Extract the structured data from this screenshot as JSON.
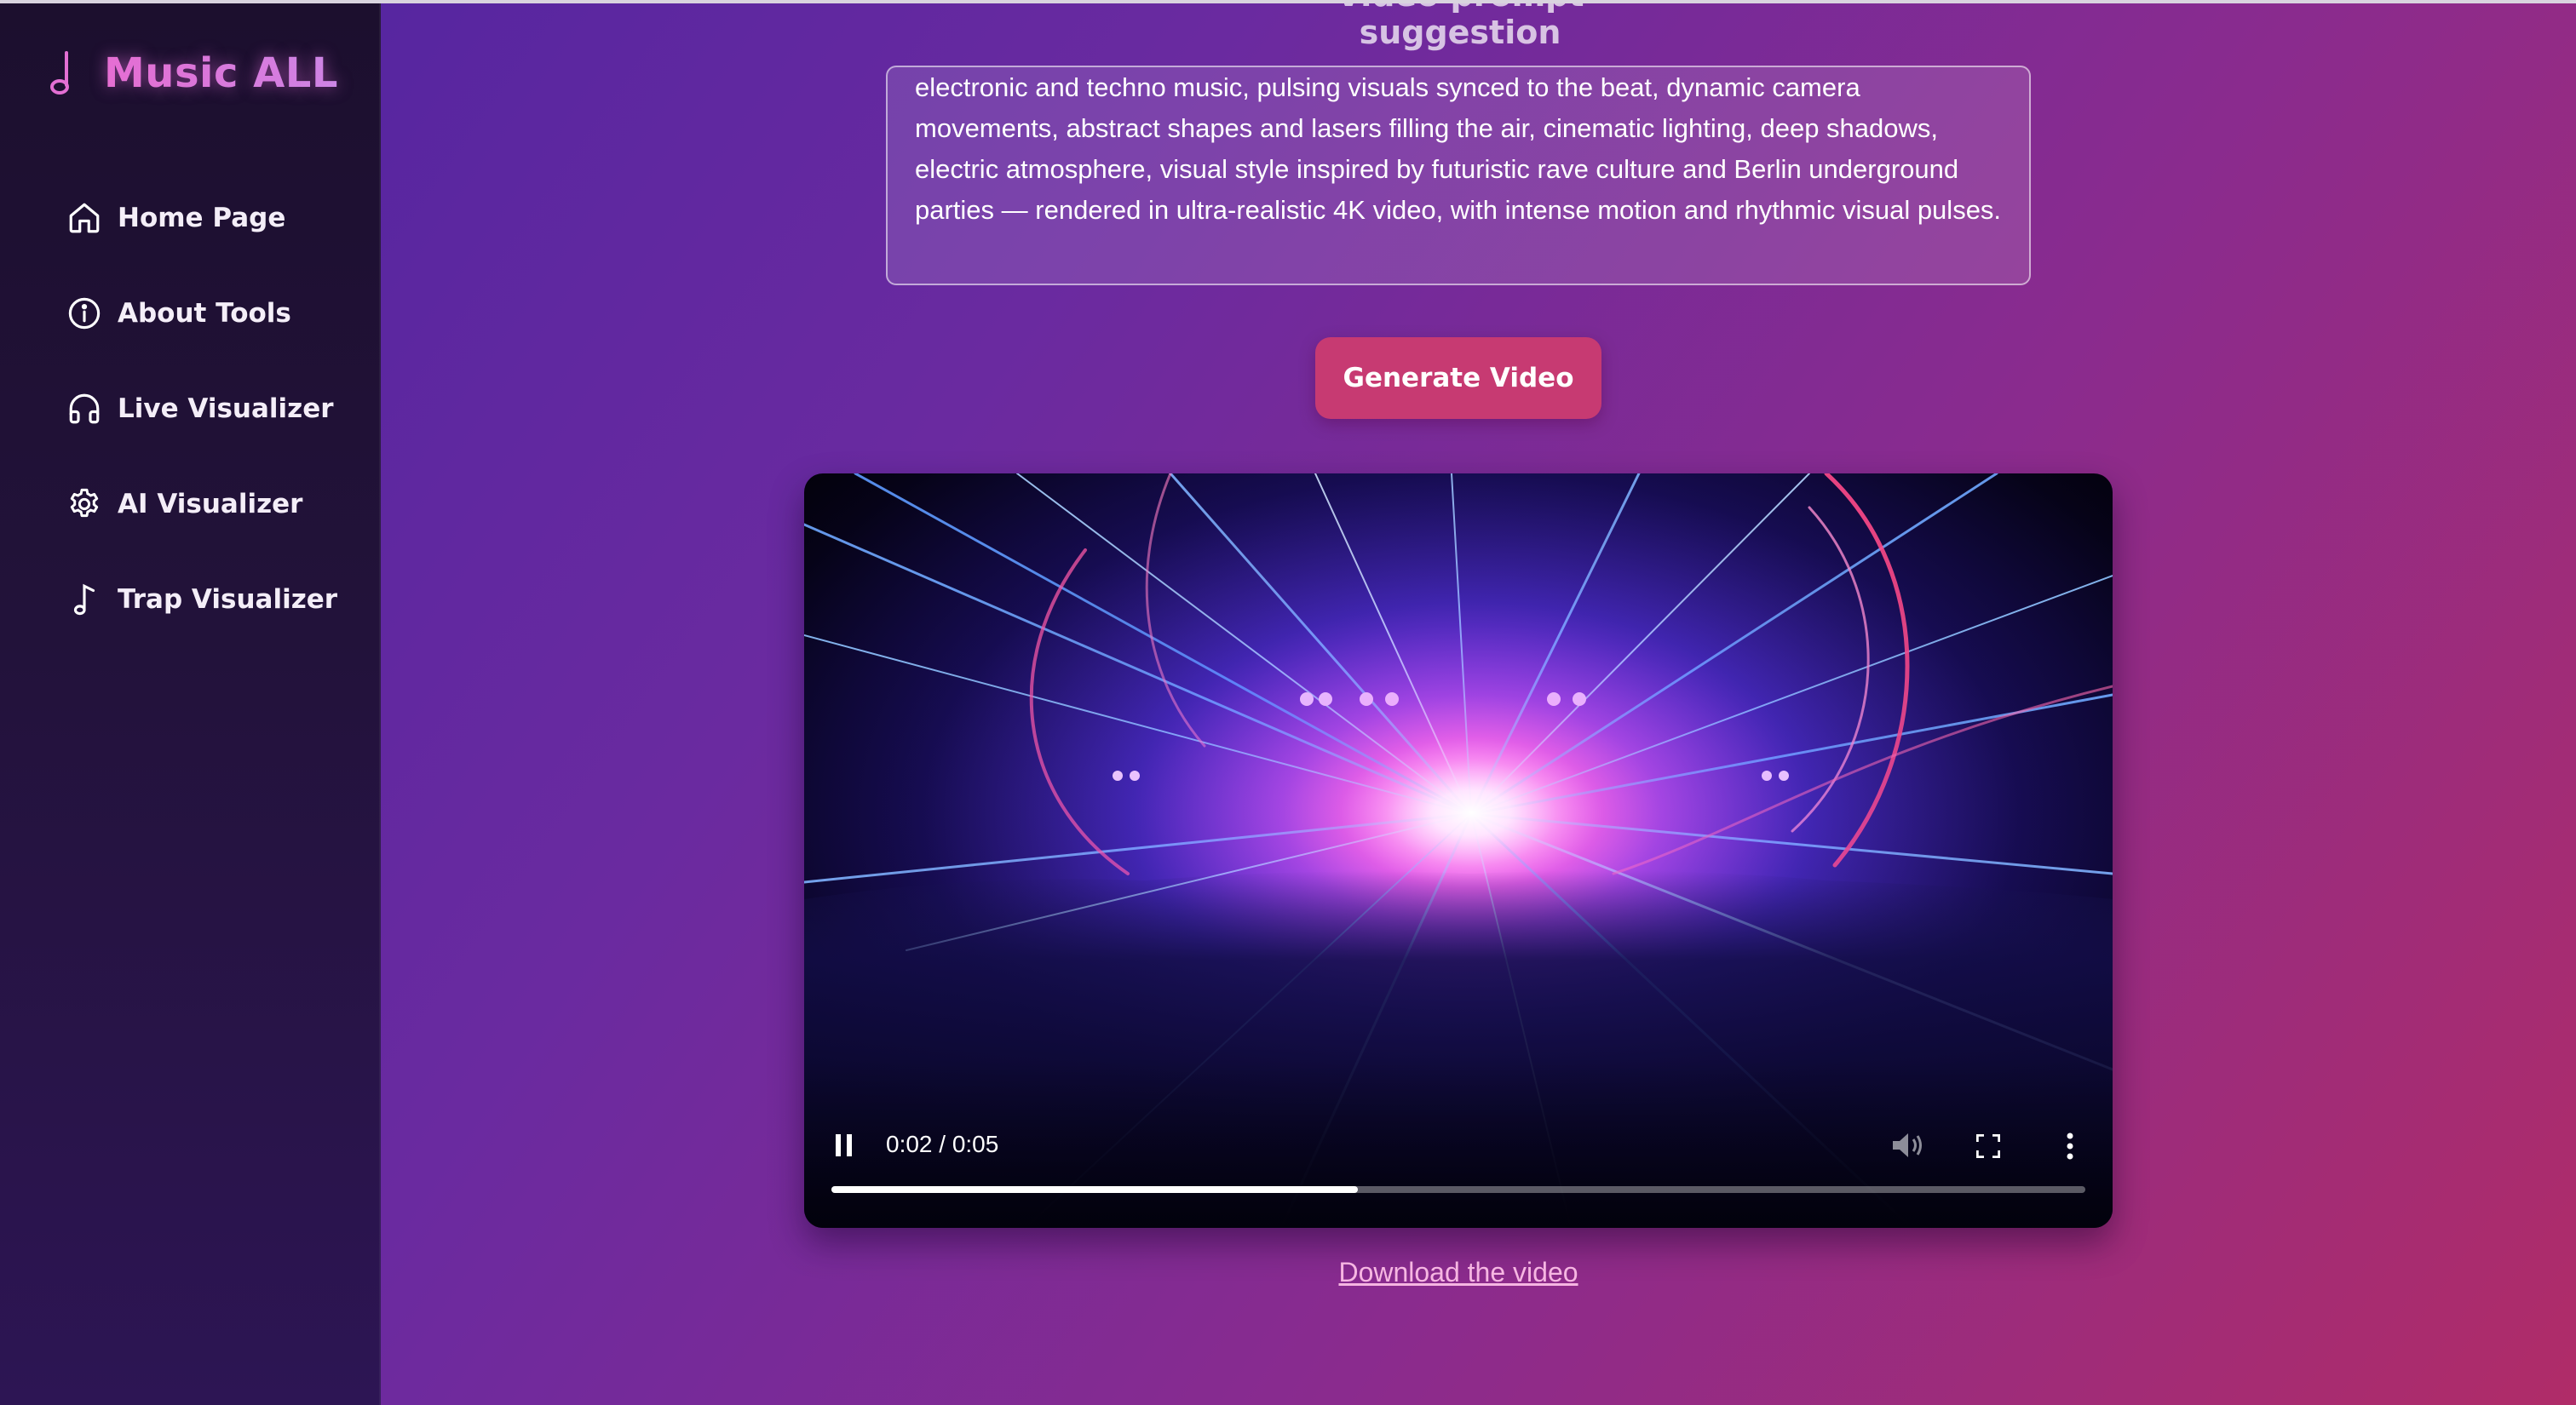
{
  "app": {
    "name": "Music ALL",
    "accent": "#e474d8"
  },
  "sidebar": {
    "items": [
      {
        "label": "Home Page",
        "icon": "home-icon"
      },
      {
        "label": "About Tools",
        "icon": "info-icon"
      },
      {
        "label": "Live Visualizer",
        "icon": "headphones-icon"
      },
      {
        "label": "AI Visualizer",
        "icon": "gear-icon"
      },
      {
        "label": "Trap Visualizer",
        "icon": "music-note-icon"
      }
    ]
  },
  "main": {
    "section_title": "Video prompt suggestion",
    "prompt_text": "electronic and techno music, pulsing visuals synced to the beat, dynamic camera movements, abstract shapes and lasers filling the air, cinematic lighting, deep shadows, electric atmosphere, visual style inspired by futuristic rave culture and Berlin underground parties — rendered in ultra-realistic 4K video, with intense motion and rhythmic visual pulses.",
    "generate_button": "Generate Video",
    "button_color": "#c73a72",
    "video": {
      "time": "0:02 / 0:05",
      "progress": 0.42,
      "state": "playing"
    },
    "download_link": "Download the video"
  }
}
